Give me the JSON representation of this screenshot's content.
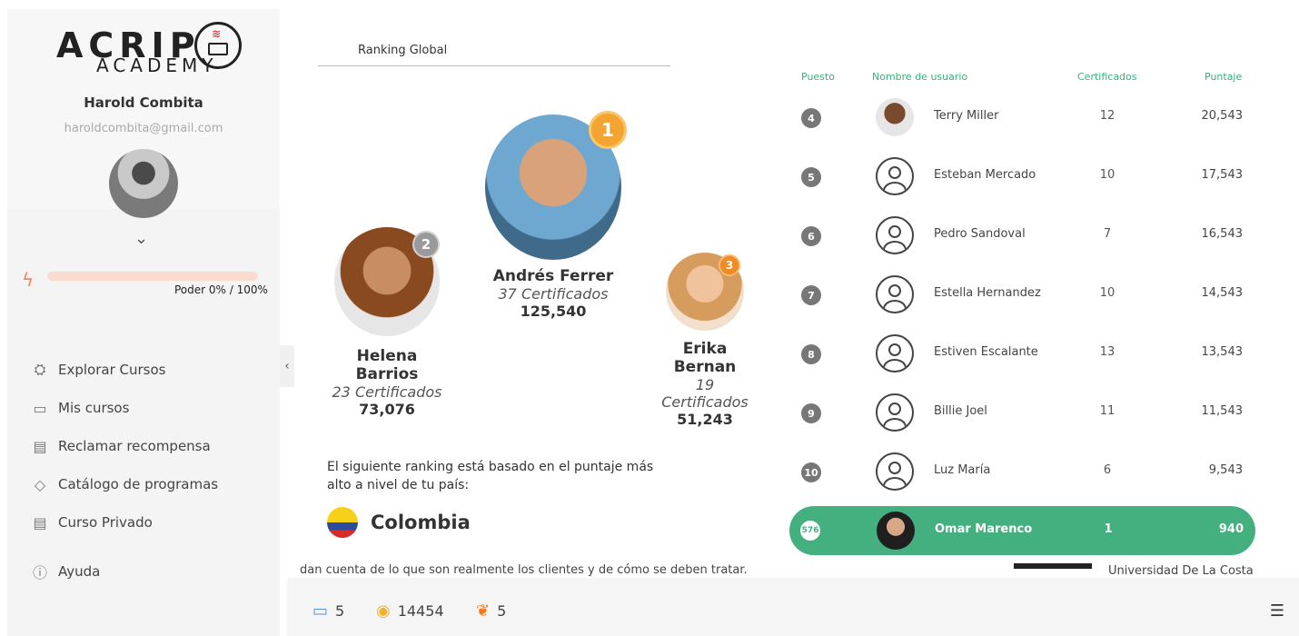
{
  "app": {
    "logo_line1": "ACRIP",
    "logo_line2": "ACADEMY"
  },
  "user": {
    "name": "Harold Combita",
    "email": "haroldcombita@gmail.com",
    "power_label": "Poder 0% / 100%",
    "power_fraction": 0.0
  },
  "nav": [
    {
      "label": "Explorar Cursos",
      "icon": "explore-icon"
    },
    {
      "label": "Mis cursos",
      "icon": "book-icon"
    },
    {
      "label": "Reclamar recompensa",
      "icon": "reward-icon"
    },
    {
      "label": "Catálogo de programas",
      "icon": "graduation-cap-icon"
    },
    {
      "label": "Curso Privado",
      "icon": "private-course-icon"
    },
    {
      "label": "Ayuda",
      "icon": "help-icon"
    }
  ],
  "main": {
    "tab_title": "Ranking Global",
    "podium": {
      "first": {
        "name": "Andrés Ferrer",
        "certs": "37 Certificados",
        "score": "125,540",
        "medal": "1"
      },
      "second": {
        "name": "Helena Barrios",
        "certs": "23 Certificados",
        "score": "73,076",
        "medal": "2"
      },
      "third": {
        "name": "Erika Bernan",
        "certs": "19 Certificados",
        "score": "51,243",
        "medal": "3"
      }
    },
    "ranking_desc": "El siguiente ranking está basado en el puntaje más alto a nivel de tu país:",
    "country": "Colombia",
    "under_text": "dan cuenta de lo que son realmente los clientes y de cómo se deben tratar.",
    "under_uni": "Universidad De La Costa"
  },
  "table": {
    "headers": {
      "rank": "Puesto",
      "user": "Nombre de usuario",
      "certs": "Certificados",
      "score": "Puntaje"
    },
    "rows": [
      {
        "rank": "4",
        "name": "Terry Miller",
        "certs": "12",
        "score": "20,543"
      },
      {
        "rank": "5",
        "name": "Esteban Mercado",
        "certs": "10",
        "score": "17,543"
      },
      {
        "rank": "6",
        "name": "Pedro Sandoval",
        "certs": "7",
        "score": "16,543"
      },
      {
        "rank": "7",
        "name": "Estella Hernandez",
        "certs": "10",
        "score": "14,543"
      },
      {
        "rank": "8",
        "name": "Estiven Escalante",
        "certs": "13",
        "score": "13,543"
      },
      {
        "rank": "9",
        "name": "Billie Joel",
        "certs": "11",
        "score": "11,543"
      },
      {
        "rank": "10",
        "name": "Luz María",
        "certs": "6",
        "score": "9,543"
      }
    ],
    "current_user": {
      "rank": "576",
      "name": "Omar Marenco",
      "certs": "1",
      "score": "940"
    }
  },
  "footer": {
    "courses_count": "5",
    "coins_count": "14454",
    "apples_count": "5"
  },
  "colors": {
    "accent_green": "#45b07f",
    "header_green": "#3cae7a",
    "power_orange": "#f08a5d"
  }
}
